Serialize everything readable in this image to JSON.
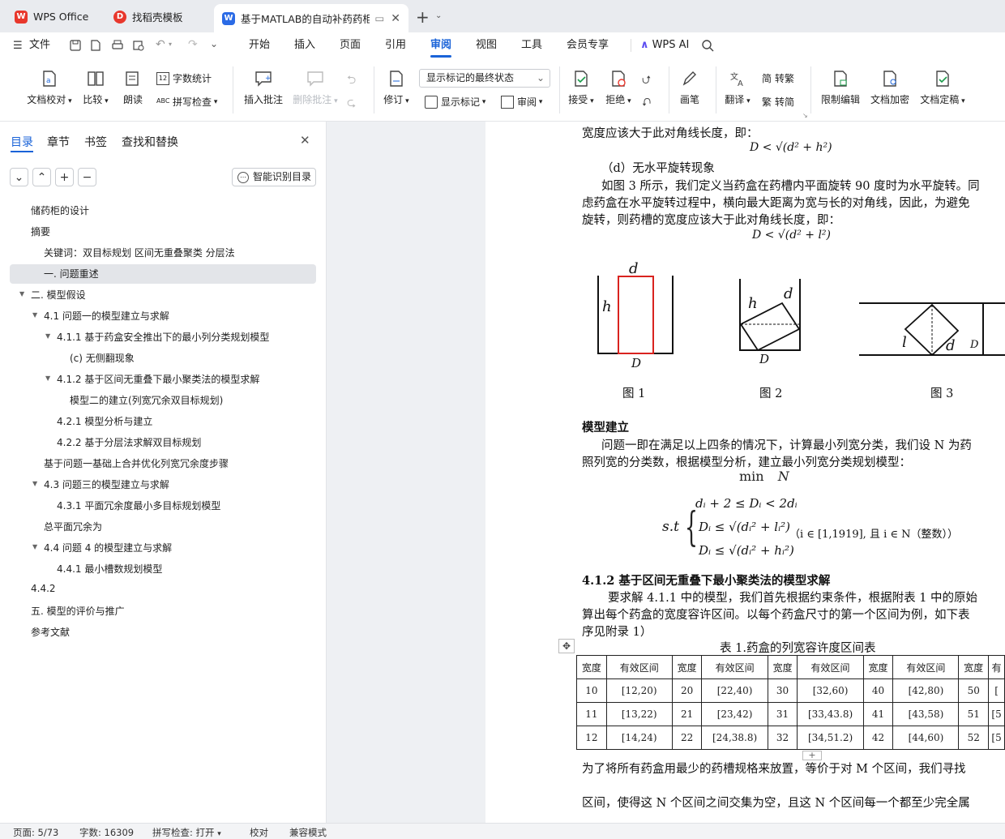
{
  "tabs": [
    {
      "label": "WPS Office",
      "icon": "wps-logo-icon"
    },
    {
      "label": "找稻壳模板",
      "icon": "docer-icon"
    },
    {
      "label": "基于MATLAB的自动补药药柜",
      "icon": "word-doc-icon",
      "active": true
    }
  ],
  "menu": {
    "file": "文件",
    "items": [
      "开始",
      "插入",
      "页面",
      "引用",
      "审阅",
      "视图",
      "工具",
      "会员专享"
    ],
    "active": "审阅",
    "ai": "WPS AI"
  },
  "ribbon": {
    "proofread": "文档校对",
    "compare": "比较",
    "read_aloud": "朗读",
    "word_count": "字数统计",
    "spell_check": "拼写检查",
    "insert_comment": "插入批注",
    "delete_comment": "删除批注",
    "revise": "修订",
    "markup_state": "显示标记的最终状态",
    "show_markup": "显示标记",
    "review": "审阅",
    "accept": "接受",
    "reject": "拒绝",
    "pen": "画笔",
    "translate": "翻译",
    "to_traditional": "转繁",
    "to_simplified": "转简",
    "restrict_edit": "限制编辑",
    "encrypt": "文档加密",
    "finalize": "文档定稿"
  },
  "panel": {
    "tabs": [
      "目录",
      "章节",
      "书签",
      "查找和替换"
    ],
    "active_tab": "目录",
    "smart_btn": "智能识别目录",
    "toc": [
      {
        "label": "储药柜的设计",
        "level": 0
      },
      {
        "label": "摘要",
        "level": 0
      },
      {
        "label": "关键词：双目标规划 区间无重叠聚类 分层法",
        "level": 1
      },
      {
        "label": "一. 问题重述",
        "level": 1,
        "selected": true
      },
      {
        "label": "二. 模型假设",
        "level": 0,
        "expand": true
      },
      {
        "label": "4.1  问题一的模型建立与求解",
        "level": 1,
        "expand": true
      },
      {
        "label": "4.1.1  基于药盒安全推出下的最小列分类规划模型",
        "level": 2,
        "expand": true
      },
      {
        "label": "(c)  无侧翻现象",
        "level": 3
      },
      {
        "label": "4.1.2     基于区间无重叠下最小聚类法的模型求解",
        "level": 2,
        "expand": true
      },
      {
        "label": "模型二的建立(列宽冗余双目标规划)",
        "level": 3
      },
      {
        "label": "4.2.1 模型分析与建立",
        "level": 2
      },
      {
        "label": "4.2.2  基于分层法求解双目标规划",
        "level": 2
      },
      {
        "label": "基于问题一基础上合并优化列宽冗余度步骤",
        "level": 1
      },
      {
        "label": "4.3  问题三的模型建立与求解",
        "level": 1,
        "expand": true
      },
      {
        "label": "4.3.1  平面冗余度最小多目标规划模型",
        "level": 2
      },
      {
        "label": "总平面冗余为",
        "level": 1
      },
      {
        "label": "4.4  问题 4 的模型建立与求解",
        "level": 1,
        "expand": true
      },
      {
        "label": "4.4.1  最小槽数规划模型",
        "level": 2
      },
      {
        "label": "4.4.2",
        "level": 0
      },
      {
        "label": "五. 模型的评价与推广",
        "level": 0
      },
      {
        "label": "参考文献",
        "level": 0
      }
    ]
  },
  "doc": {
    "p1": "宽度应该大于此对角线长度，即：",
    "eq1": "D < √(d² + h²)",
    "p2": "（d）无水平旋转现象",
    "p3": "如图 3 所示，我们定义当药盒在药槽内平面旋转 90 度时为水平旋转。同",
    "p4": "虑药盒在水平旋转过程中，横向最大距离为宽与长的对角线，因此，为避免",
    "p5": "旋转，则药槽的宽度应该大于此对角线长度，即：",
    "eq2": "D < √(d² + l²)",
    "fig_captions": [
      "图 1",
      "图 2",
      "图 3"
    ],
    "fig_labels": {
      "d": "d",
      "h": "h",
      "D": "D",
      "l": "l"
    },
    "h_model": "模型建立",
    "p6": "问题一即在满足以上四条的情况下，计算最小列宽分类，我们设 N 为药",
    "p7": "照列宽的分类数，根据模型分析，建立最小列宽分类规划模型：",
    "min_label": "min",
    "min_var": "N",
    "st": "s.t",
    "c1": "dᵢ + 2 ≤ Dᵢ < 2dᵢ",
    "c2": "Dᵢ ≤ √(dᵢ² + lᵢ²)",
    "c3": "Dᵢ ≤ √(dᵢ² + hᵢ²)",
    "cond": "（i ∈ [1,1919], 且 i ∈ N（整数））",
    "h412": "4.1.2    基于区间无重叠下最小聚类法的模型求解",
    "p8": "要求解 4.1.1 中的模型，我们首先根据约束条件，根据附表 1 中的原始",
    "p9": "算出每个药盒的宽度容许区间。以每个药盒尺寸的第一个区间为例，如下表",
    "p10": "序见附录 1）",
    "table_title": "表 1.药盒的列宽容许度区间表",
    "table_header": [
      "宽度",
      "有效区间",
      "宽度",
      "有效区间",
      "宽度",
      "有效区间",
      "宽度",
      "有效区间",
      "宽度",
      "有"
    ],
    "table_rows": [
      [
        "10",
        "[12,20)",
        "20",
        "[22,40)",
        "30",
        "[32,60)",
        "40",
        "[42,80)",
        "50",
        "["
      ],
      [
        "11",
        "[13,22)",
        "21",
        "[23,42)",
        "31",
        "[33,43.8)",
        "41",
        "[43,58)",
        "51",
        "[5"
      ],
      [
        "12",
        "[14,24)",
        "22",
        "[24,38.8)",
        "32",
        "[34,51.2)",
        "42",
        "[44,60)",
        "52",
        "[5"
      ]
    ],
    "p11": "为了将所有药盒用最少的药槽规格来放置，等价于对 M 个区间，我们寻找",
    "p12": "区间，使得这 N 个区间之间交集为空，且这 N 个区间每一个都至少完全属"
  },
  "status": {
    "page": "页面: 5/73",
    "words": "字数: 16309",
    "spell": "拼写检查: 打开",
    "proof": "校对",
    "compat": "兼容模式"
  },
  "colors": {
    "accent": "#1a63d8",
    "wps_red": "#e8372c",
    "figure_red": "#d9231f"
  }
}
